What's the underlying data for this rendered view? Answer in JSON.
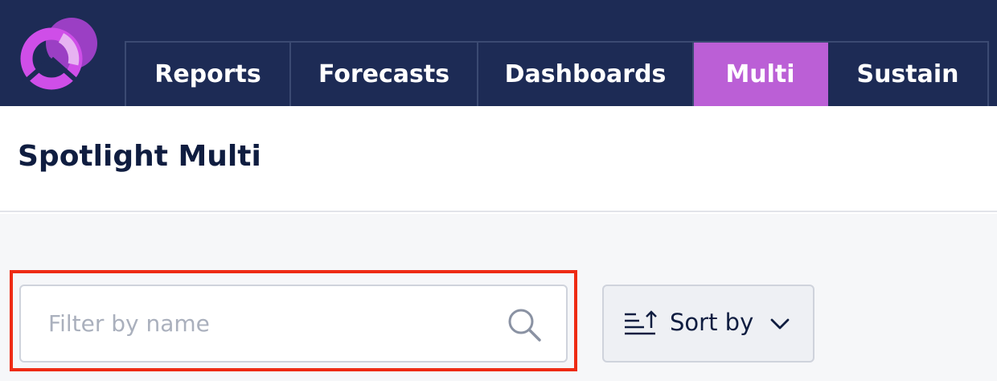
{
  "nav": {
    "tabs": [
      {
        "label": "Reports",
        "active": false
      },
      {
        "label": "Forecasts",
        "active": false
      },
      {
        "label": "Dashboards",
        "active": false
      },
      {
        "label": "Multi",
        "active": true
      },
      {
        "label": "Sustain",
        "active": false
      }
    ]
  },
  "page": {
    "title": "Spotlight Multi"
  },
  "filter": {
    "placeholder": "Filter by name",
    "value": "",
    "icon": "search-icon"
  },
  "sort": {
    "label": "Sort by",
    "icon": "sort-ascending-icon",
    "chevron_icon": "chevron-down-icon"
  },
  "colors": {
    "navbar": "#1d2b55",
    "active_tab": "#bb5fd6",
    "title_text": "#0f1d40",
    "highlight": "#ee2b14",
    "content_bg": "#f6f7f9"
  }
}
